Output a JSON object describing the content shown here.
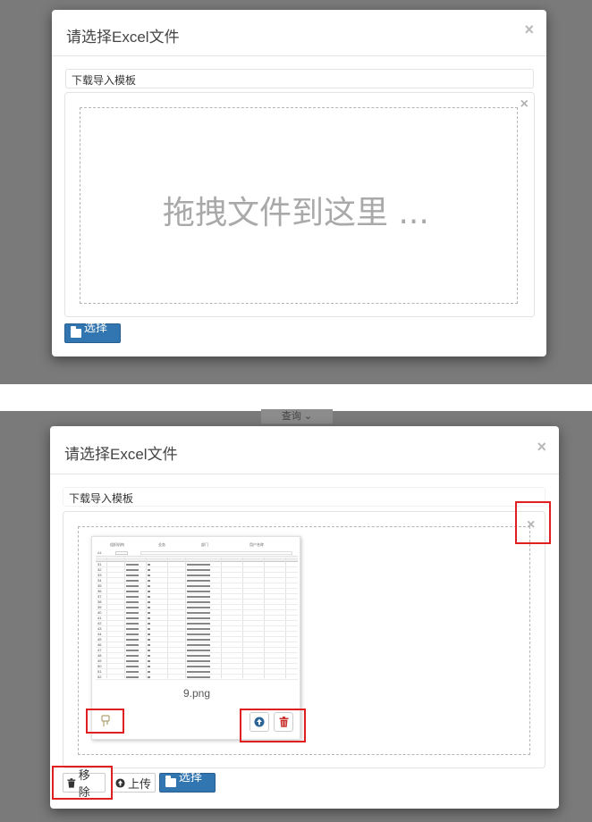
{
  "dialog_before": {
    "title": "请选择Excel文件",
    "close_glyph": "×",
    "template_link": "下载导入模板",
    "dropzone_text": "拖拽文件到这里 ...",
    "zone_close_glyph": "×",
    "browse_label": "选择 ..."
  },
  "dialog_after": {
    "top_chip": "查询",
    "title": "请选择Excel文件",
    "close_glyph": "×",
    "template_link": "下载导入模板",
    "zone_close_glyph": "×",
    "preview": {
      "file_name": "9.png",
      "sheet_header": [
        "组织机构",
        "业务",
        "部门",
        "用户名称"
      ],
      "sheet_cell_ref": "A1",
      "sheet_row_numbers": [
        "31",
        "32",
        "33",
        "34",
        "35",
        "36",
        "37",
        "38",
        "39",
        "40",
        "41",
        "42",
        "43",
        "44",
        "45",
        "46",
        "47",
        "48",
        "49",
        "50",
        "51",
        "52"
      ]
    },
    "remove_label": "移除",
    "upload_label": "上传",
    "browse_label": "选择 ..."
  },
  "colors": {
    "primary": "#3276b1",
    "highlight": "#e02020",
    "delete": "#c9302c"
  },
  "icons": [
    "close-icon",
    "folder-open-icon",
    "trash-icon",
    "upload-icon",
    "drag-icon"
  ]
}
